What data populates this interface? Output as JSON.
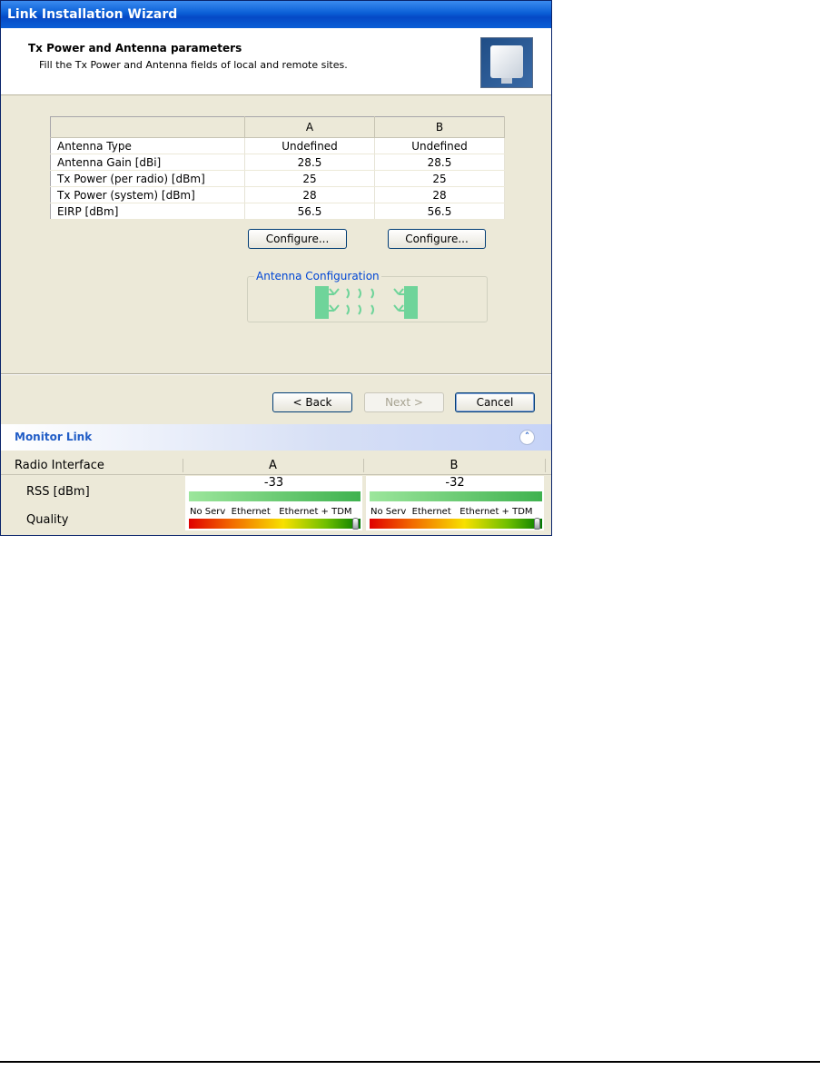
{
  "window": {
    "title": "Link Installation Wizard"
  },
  "header": {
    "title": "Tx Power and Antenna parameters",
    "subtitle": "Fill the Tx Power and Antenna fields of local and remote sites."
  },
  "params_table": {
    "columns": [
      "",
      "A",
      "B"
    ],
    "rows": [
      {
        "label": "Antenna Type",
        "a": "Undefined",
        "b": "Undefined"
      },
      {
        "label": "Antenna Gain [dBi]",
        "a": "28.5",
        "b": "28.5"
      },
      {
        "label": "Tx Power (per radio) [dBm]",
        "a": "25",
        "b": "25"
      },
      {
        "label": "Tx Power (system) [dBm]",
        "a": "28",
        "b": "28"
      },
      {
        "label": "EIRP [dBm]",
        "a": "56.5",
        "b": "56.5"
      }
    ]
  },
  "configure_a": "Configure...",
  "configure_b": "Configure...",
  "antenna_config": {
    "legend": "Antenna Configuration"
  },
  "nav": {
    "back": "< Back",
    "next": "Next >",
    "cancel": "Cancel"
  },
  "monitor": {
    "title": "Monitor Link",
    "header": {
      "label": "Radio Interface",
      "a": "A",
      "b": "B"
    },
    "rss_label": "RSS [dBm]",
    "quality_label": "Quality",
    "rss_a": "-33",
    "rss_b": "-32",
    "quality_levels": [
      "No Serv",
      "Ethernet",
      "Ethernet + TDM"
    ],
    "quality_a_level": 1.0,
    "quality_b_level": 1.0
  }
}
